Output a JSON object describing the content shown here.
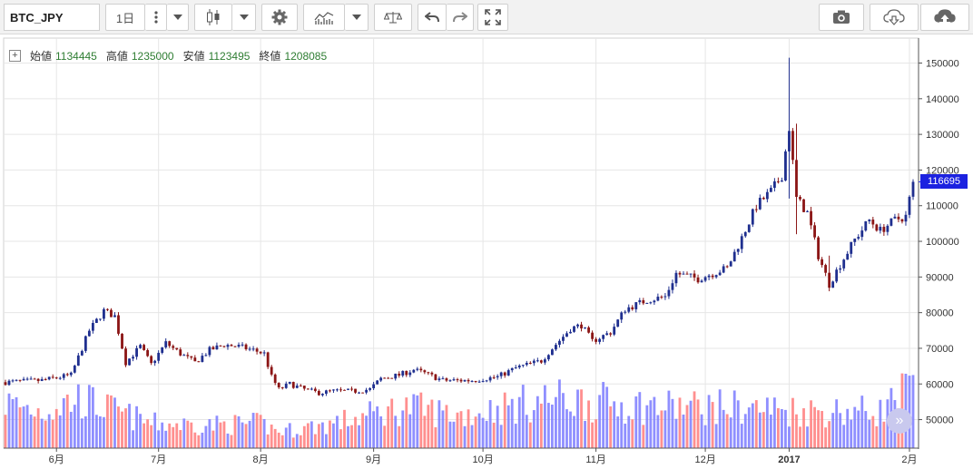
{
  "toolbar": {
    "symbol": "BTC_JPY",
    "interval": "1日",
    "icons": [
      "compare-icon",
      "dropdown-icon",
      "candlestick-icon",
      "dropdown-icon",
      "settings-icon",
      "indicators-icon",
      "dropdown-icon",
      "scale-icon",
      "undo-icon",
      "redo-icon",
      "fullscreen-icon",
      "camera-icon",
      "cloud-download-icon",
      "cloud-upload-icon"
    ]
  },
  "legend": {
    "open_label": "始値",
    "open": "1134445",
    "high_label": "高値",
    "high": "1235000",
    "low_label": "安値",
    "low": "1123495",
    "close_label": "終値",
    "close": "1208085"
  },
  "current_price": "116695",
  "colors": {
    "up": "#1f2f8f",
    "down": "#8b1515",
    "vol_up": "#7b7bff",
    "vol_down": "#ff7b7b",
    "price_tag": "#1c22e0"
  },
  "chart_data": {
    "type": "candlestick",
    "symbol": "BTC_JPY",
    "interval": "1日",
    "y_ticks": [
      50000,
      60000,
      70000,
      80000,
      90000,
      100000,
      110000,
      120000,
      130000,
      140000,
      150000
    ],
    "y_tick_labels": [
      "50000",
      "60000",
      "70000",
      "80000",
      "90000",
      "100000",
      "110000",
      "120000",
      "130000",
      "140000",
      "150000"
    ],
    "ylim": [
      42000,
      157000
    ],
    "x_labels": [
      "6月",
      "7月",
      "8月",
      "9月",
      "10月",
      "11月",
      "12月",
      "2017",
      "2月"
    ],
    "x_label_bold": [
      false,
      false,
      false,
      false,
      false,
      false,
      false,
      true,
      false
    ],
    "close_series": [
      {
        "x": 0,
        "y": 60500
      },
      {
        "x": 10,
        "y": 61000
      },
      {
        "x": 18,
        "y": 62500
      },
      {
        "x": 23,
        "y": 75000
      },
      {
        "x": 27,
        "y": 80500
      },
      {
        "x": 30,
        "y": 79000
      },
      {
        "x": 33,
        "y": 66000
      },
      {
        "x": 37,
        "y": 70500
      },
      {
        "x": 40,
        "y": 65500
      },
      {
        "x": 44,
        "y": 71500
      },
      {
        "x": 48,
        "y": 68500
      },
      {
        "x": 52,
        "y": 66000
      },
      {
        "x": 56,
        "y": 69500
      },
      {
        "x": 60,
        "y": 71000
      },
      {
        "x": 64,
        "y": 70500
      },
      {
        "x": 68,
        "y": 69500
      },
      {
        "x": 71,
        "y": 68500
      },
      {
        "x": 73,
        "y": 62000
      },
      {
        "x": 75,
        "y": 58500
      },
      {
        "x": 78,
        "y": 60000
      },
      {
        "x": 82,
        "y": 58500
      },
      {
        "x": 86,
        "y": 57500
      },
      {
        "x": 90,
        "y": 58000
      },
      {
        "x": 96,
        "y": 58000
      },
      {
        "x": 100,
        "y": 58500
      },
      {
        "x": 103,
        "y": 61500
      },
      {
        "x": 108,
        "y": 62500
      },
      {
        "x": 112,
        "y": 64000
      },
      {
        "x": 115,
        "y": 63000
      },
      {
        "x": 120,
        "y": 61000
      },
      {
        "x": 128,
        "y": 61000
      },
      {
        "x": 135,
        "y": 62000
      },
      {
        "x": 140,
        "y": 64500
      },
      {
        "x": 147,
        "y": 66500
      },
      {
        "x": 150,
        "y": 70000
      },
      {
        "x": 155,
        "y": 75500
      },
      {
        "x": 158,
        "y": 76500
      },
      {
        "x": 161,
        "y": 72000
      },
      {
        "x": 166,
        "y": 74500
      },
      {
        "x": 170,
        "y": 81000
      },
      {
        "x": 176,
        "y": 83500
      },
      {
        "x": 181,
        "y": 84500
      },
      {
        "x": 184,
        "y": 91000
      },
      {
        "x": 190,
        "y": 89500
      },
      {
        "x": 198,
        "y": 92500
      },
      {
        "x": 202,
        "y": 101000
      },
      {
        "x": 206,
        "y": 110000
      },
      {
        "x": 210,
        "y": 114000
      },
      {
        "x": 213,
        "y": 118500
      },
      {
        "x": 215,
        "y": 132000
      },
      {
        "x": 217,
        "y": 112000
      },
      {
        "x": 220,
        "y": 108000
      },
      {
        "x": 223,
        "y": 96000
      },
      {
        "x": 226,
        "y": 88000
      },
      {
        "x": 229,
        "y": 93500
      },
      {
        "x": 233,
        "y": 100500
      },
      {
        "x": 237,
        "y": 106000
      },
      {
        "x": 240,
        "y": 103000
      },
      {
        "x": 244,
        "y": 106000
      },
      {
        "x": 247,
        "y": 107000
      },
      {
        "x": 249,
        "y": 116695
      }
    ],
    "spikes": [
      {
        "x": 215,
        "high": 151500,
        "low": 112000
      },
      {
        "x": 217,
        "high": 133000,
        "low": 102000
      },
      {
        "x": 226,
        "high": 96000,
        "low": 86000
      }
    ],
    "volume_profile": [
      {
        "x": 0,
        "v": 0.55
      },
      {
        "x": 10,
        "v": 0.45
      },
      {
        "x": 20,
        "v": 0.6
      },
      {
        "x": 30,
        "v": 0.45
      },
      {
        "x": 40,
        "v": 0.3
      },
      {
        "x": 55,
        "v": 0.28
      },
      {
        "x": 70,
        "v": 0.3
      },
      {
        "x": 75,
        "v": 0.2
      },
      {
        "x": 90,
        "v": 0.3
      },
      {
        "x": 110,
        "v": 0.5
      },
      {
        "x": 125,
        "v": 0.4
      },
      {
        "x": 150,
        "v": 0.6
      },
      {
        "x": 165,
        "v": 0.55
      },
      {
        "x": 180,
        "v": 0.5
      },
      {
        "x": 200,
        "v": 0.5
      },
      {
        "x": 220,
        "v": 0.45
      },
      {
        "x": 240,
        "v": 0.45
      },
      {
        "x": 249,
        "v": 0.75
      }
    ],
    "last_price": 116695
  },
  "scroll_button": "»"
}
